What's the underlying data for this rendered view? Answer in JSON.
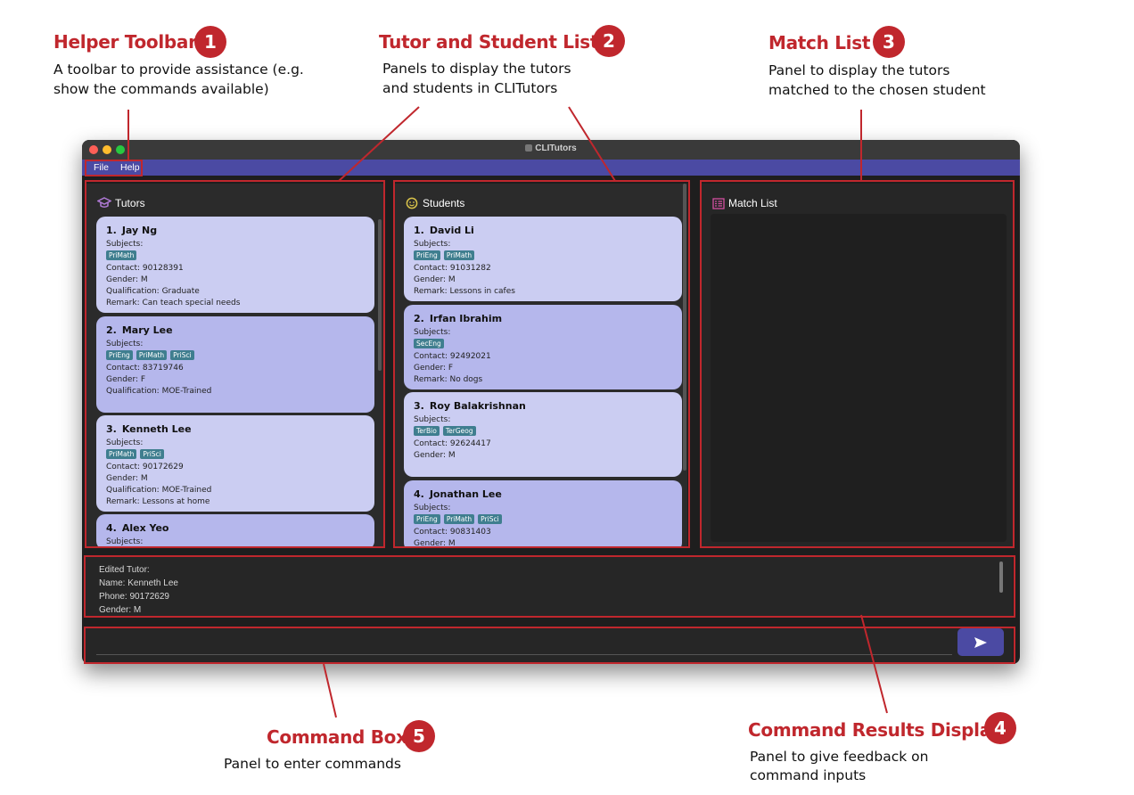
{
  "annotations": [
    {
      "num": "1",
      "title": "Helper Toolbar",
      "desc": [
        "A toolbar to provide assistance (e.g.",
        "show the commands available)"
      ]
    },
    {
      "num": "2",
      "title": "Tutor and Student Lists",
      "desc": [
        "Panels to display the tutors",
        "and students in CLITutors"
      ]
    },
    {
      "num": "3",
      "title": "Match List",
      "desc": [
        "Panel to display the tutors",
        "matched to the chosen student"
      ]
    },
    {
      "num": "4",
      "title": "Command Results Display",
      "desc": [
        "Panel to give feedback on",
        "command  inputs"
      ]
    },
    {
      "num": "5",
      "title": "Command Box",
      "desc": [
        "Panel to enter commands"
      ]
    }
  ],
  "window": {
    "title": "CLITutors"
  },
  "menu": {
    "file": "File",
    "help": "Help"
  },
  "tutors": {
    "header": "Tutors",
    "cards": [
      {
        "index": "1.",
        "name": "Jay Ng",
        "subjects_label": "Subjects:",
        "tags": [
          "PriMath"
        ],
        "lines": [
          "Contact: 90128391",
          "Gender: M",
          "Qualification: Graduate",
          "Remark: Can teach special needs"
        ]
      },
      {
        "index": "2.",
        "name": "Mary Lee",
        "subjects_label": "Subjects:",
        "tags": [
          "PriEng",
          "PriMath",
          "PriSci"
        ],
        "lines": [
          "Contact: 83719746",
          "Gender: F",
          "Qualification: MOE-Trained"
        ]
      },
      {
        "index": "3.",
        "name": "Kenneth Lee",
        "subjects_label": "Subjects:",
        "tags": [
          "PriMath",
          "PriSci"
        ],
        "lines": [
          "Contact: 90172629",
          "Gender: M",
          "Qualification: MOE-Trained",
          "Remark: Lessons at home"
        ]
      },
      {
        "index": "4.",
        "name": "Alex Yeo",
        "subjects_label": "Subjects:",
        "tags": [],
        "lines": []
      }
    ]
  },
  "students": {
    "header": "Students",
    "cards": [
      {
        "index": "1.",
        "name": "David Li",
        "subjects_label": "Subjects:",
        "tags": [
          "PriEng",
          "PriMath"
        ],
        "lines": [
          "Contact: 91031282",
          "Gender: M",
          "Remark: Lessons in cafes"
        ]
      },
      {
        "index": "2.",
        "name": "Irfan Ibrahim",
        "subjects_label": "Subjects:",
        "tags": [
          "SecEng"
        ],
        "lines": [
          "Contact: 92492021",
          "Gender: F",
          "Remark: No dogs"
        ]
      },
      {
        "index": "3.",
        "name": "Roy Balakrishnan",
        "subjects_label": "Subjects:",
        "tags": [
          "TerBio",
          "TerGeog"
        ],
        "lines": [
          "Contact: 92624417",
          "Gender: M"
        ]
      },
      {
        "index": "4.",
        "name": "Jonathan Lee",
        "subjects_label": "Subjects:",
        "tags": [
          "PriEng",
          "PriMath",
          "PriSci"
        ],
        "lines": [
          "Contact: 90831403",
          "Gender: M"
        ]
      }
    ]
  },
  "match_list": {
    "header": "Match List"
  },
  "result_display": {
    "lines": [
      "Edited Tutor:",
      "Name: Kenneth Lee",
      "Phone: 90172629",
      "Gender: M"
    ]
  },
  "command_box": {
    "value": "",
    "send_icon": "send-icon"
  },
  "colors": {
    "annotation_red": "#c0272d",
    "menubar": "#4b4aa3",
    "card_light": "#cbcdf2",
    "card_dark": "#b5b7ec",
    "tag": "#3f7e8f"
  }
}
